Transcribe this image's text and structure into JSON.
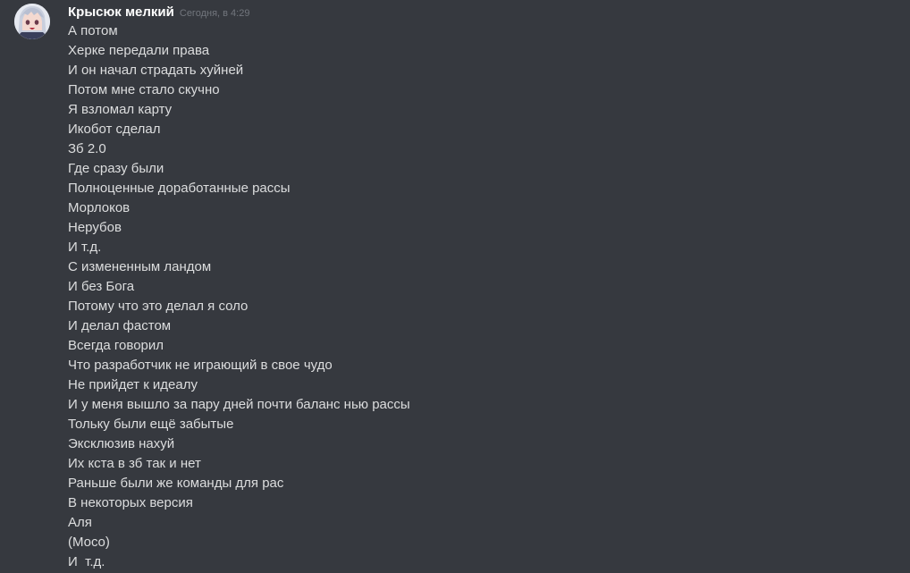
{
  "message": {
    "author": "Крысюк мелкий",
    "timestamp": "Сегодня, в 4:29",
    "avatar_icon": "anime-avatar",
    "lines": [
      "А потом",
      "Херке передали права",
      "И он начал страдать хуйней",
      "Потом мне стало скучно",
      "Я взломал карту",
      "Икобот сделал",
      "Зб 2.0",
      "Где сразу были",
      "Полноценные доработанные рассы",
      "Морлоков",
      "Нерубов",
      "И т.д.",
      "С измененным ландом",
      "И без Бога",
      "Потому что это делал я соло",
      "И делал фастом",
      "Всегда говорил",
      "Что разработчик не играющий в свое чудо",
      "Не прийдет к идеалу",
      "И у меня вышло за пару дней почти баланс нью рассы",
      "Тольку были ещё забытые",
      "Эксклюзив нахуй",
      "Их кста в зб так и нет",
      "Раньше были же команды для рас",
      "В некоторых версия",
      "Аля",
      "(Моco)",
      "И  т.д."
    ]
  },
  "colors": {
    "background": "#36393f",
    "username": "#ffffff",
    "timestamp": "#72767d",
    "text": "#dcddde"
  }
}
